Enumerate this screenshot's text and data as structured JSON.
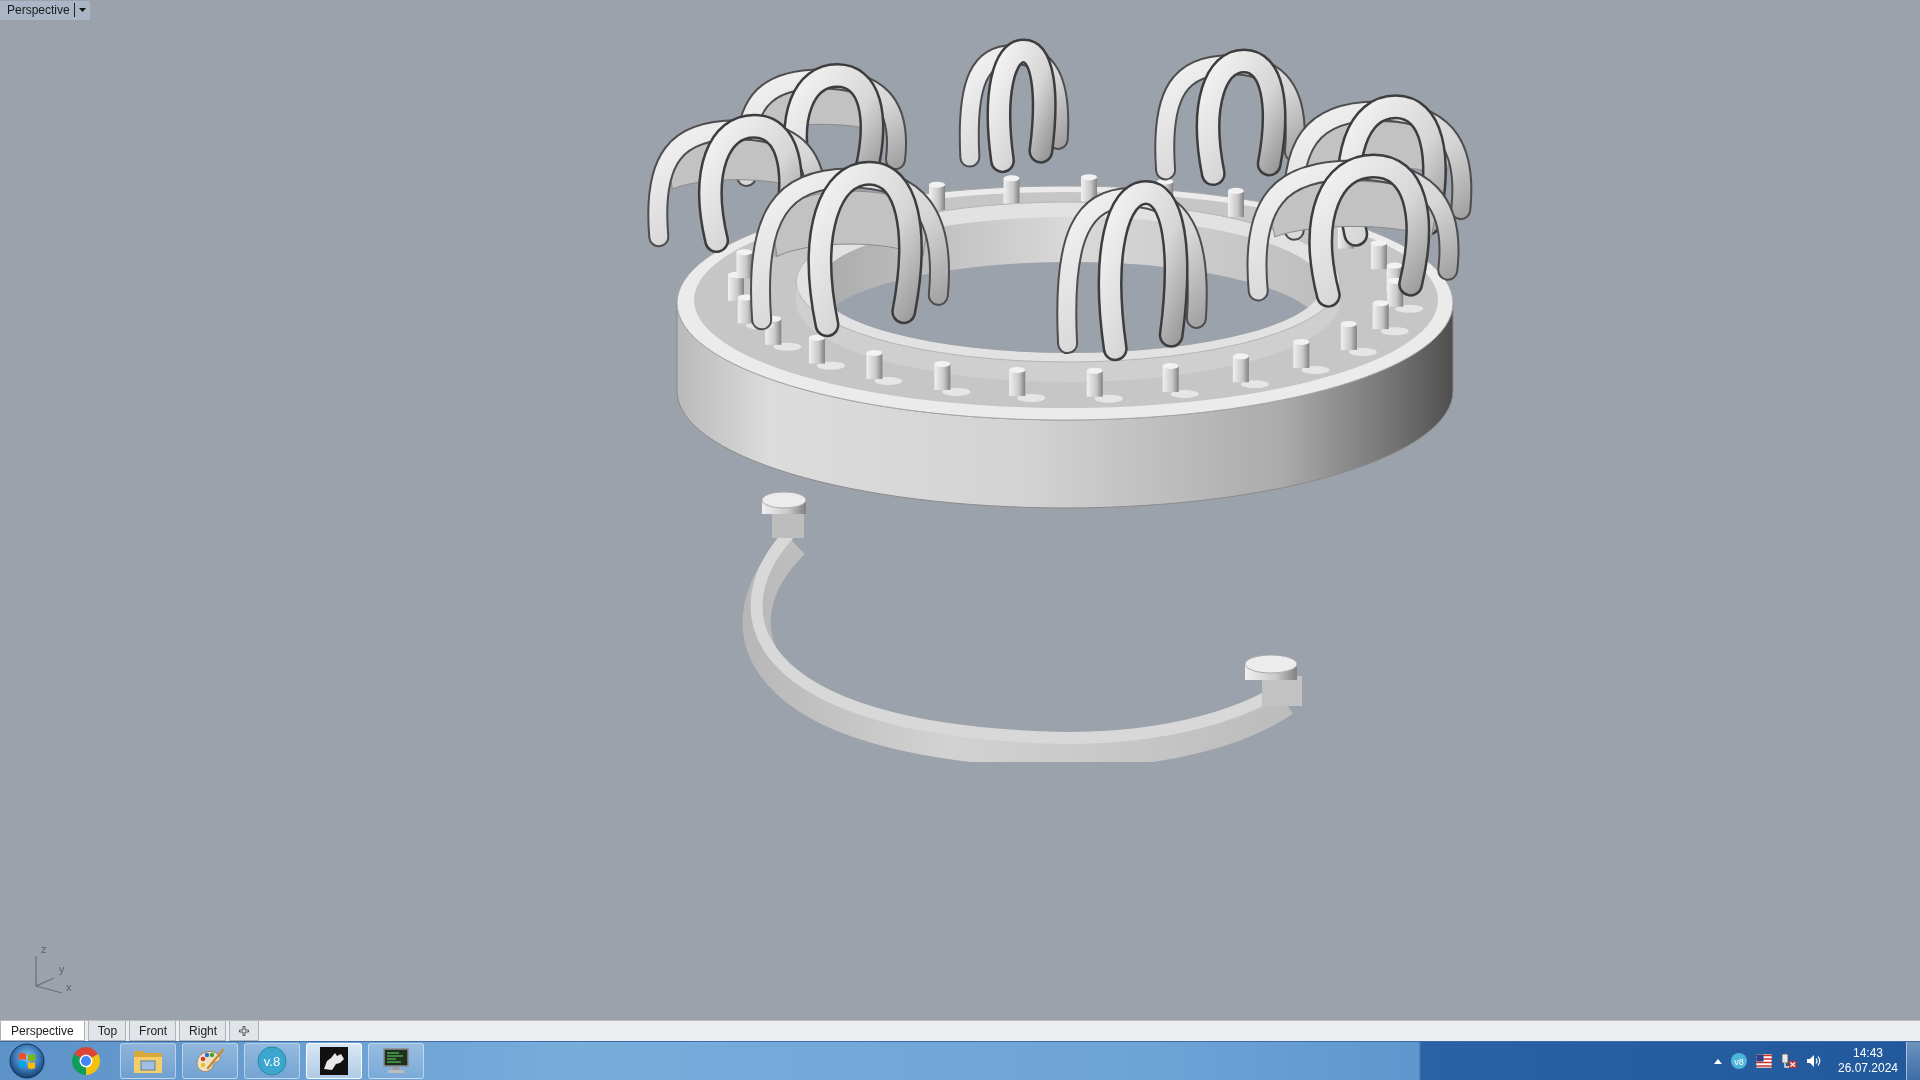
{
  "viewport": {
    "title": "Perspective",
    "axes": [
      {
        "label": "z"
      },
      {
        "label": "y"
      },
      {
        "label": "x"
      }
    ]
  },
  "viewport_tabs": [
    {
      "label": "Perspective",
      "selected": true
    },
    {
      "label": "Top",
      "selected": false
    },
    {
      "label": "Front",
      "selected": false
    },
    {
      "label": "Right",
      "selected": false
    }
  ],
  "taskbar": {
    "apps": [
      {
        "kind": "browser",
        "running": false,
        "selected": false
      },
      {
        "kind": "folder",
        "running": true,
        "selected": false
      },
      {
        "kind": "palette",
        "running": true,
        "selected": false
      },
      {
        "kind": "badge",
        "label": "v.8",
        "running": true,
        "selected": false
      },
      {
        "kind": "tile",
        "running": true,
        "selected": true
      },
      {
        "kind": "monitor",
        "running": true,
        "selected": false
      }
    ],
    "tray": [
      {
        "kind": "caret"
      },
      {
        "kind": "badge",
        "label": "v8"
      },
      {
        "kind": "flag"
      },
      {
        "kind": "network"
      },
      {
        "kind": "speaker"
      }
    ],
    "clock": {
      "time": "14:43",
      "date": "26.07.2024"
    }
  }
}
